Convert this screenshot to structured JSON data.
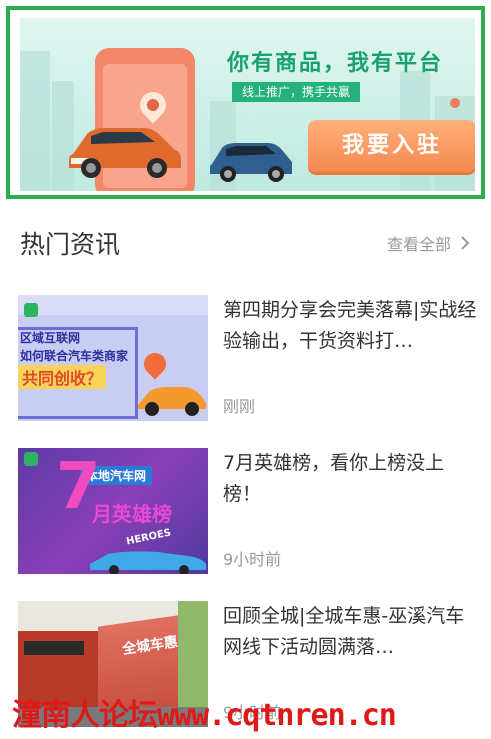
{
  "banner": {
    "slogan": "你有商品，我有平台",
    "subslogan": "线上推广，携手共赢",
    "join_button": "我要入驻"
  },
  "section": {
    "title": "热门资讯",
    "view_all": "查看全部"
  },
  "news": [
    {
      "title": "第四期分享会完美落幕|实战经验输出，干货资料打…",
      "time": "刚刚",
      "thumb_text": [
        "区域互联网",
        "如何联合汽车类商家",
        "共同创收？"
      ]
    },
    {
      "title": "7月英雄榜，看你上榜没上榜！",
      "time": "9小时前",
      "thumb_text": [
        "本地汽车网",
        "7",
        "月英雄榜",
        "HEROES"
      ]
    },
    {
      "title": "回顾全城|全城车惠-巫溪汽车网线下活动圆满落…",
      "time": "9小时前",
      "thumb_text": [
        "全城车惠"
      ]
    }
  ],
  "watermark": "潼南人论坛www.cqtnren.cn",
  "colors": {
    "banner_border": "#29b04a",
    "accent_green": "#1aa16d",
    "button_orange": "#f5894e",
    "watermark_red": "#e01818"
  }
}
